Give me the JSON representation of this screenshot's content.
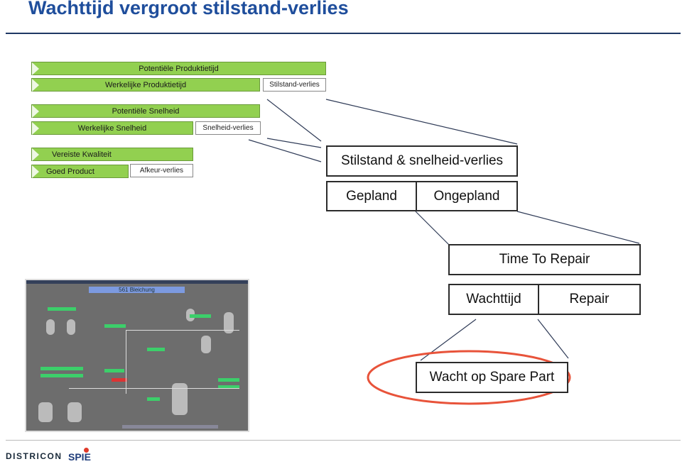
{
  "title": "Wachttijd vergroot stilstand-verlies",
  "bars": {
    "potential_time": "Potentiële Produktietijd",
    "actual_time": "Werkelijke Produktietijd",
    "downtime_loss": "Stilstand-verlies",
    "potential_speed": "Potentiële Snelheid",
    "actual_speed": "Werkelijke Snelheid",
    "speed_loss": "Snelheid-verlies",
    "required_quality": "Vereiste Kwaliteit",
    "good_product": "Goed Product",
    "reject_loss": "Afkeur-verlies"
  },
  "tree": {
    "root": "Stilstand & snelheid-verlies",
    "planned": "Gepland",
    "unplanned": "Ongepland",
    "ttr": "Time To Repair",
    "wait": "Wachttijd",
    "repair": "Repair",
    "spare": "Wacht op Spare Part"
  },
  "scada": {
    "title": "561 Bleichung"
  },
  "logos": {
    "districon": "DISTRICON",
    "spie": "SPIE"
  },
  "colors": {
    "green": "#92d050",
    "title": "#1f4e9c",
    "highlight": "#e8533a"
  }
}
